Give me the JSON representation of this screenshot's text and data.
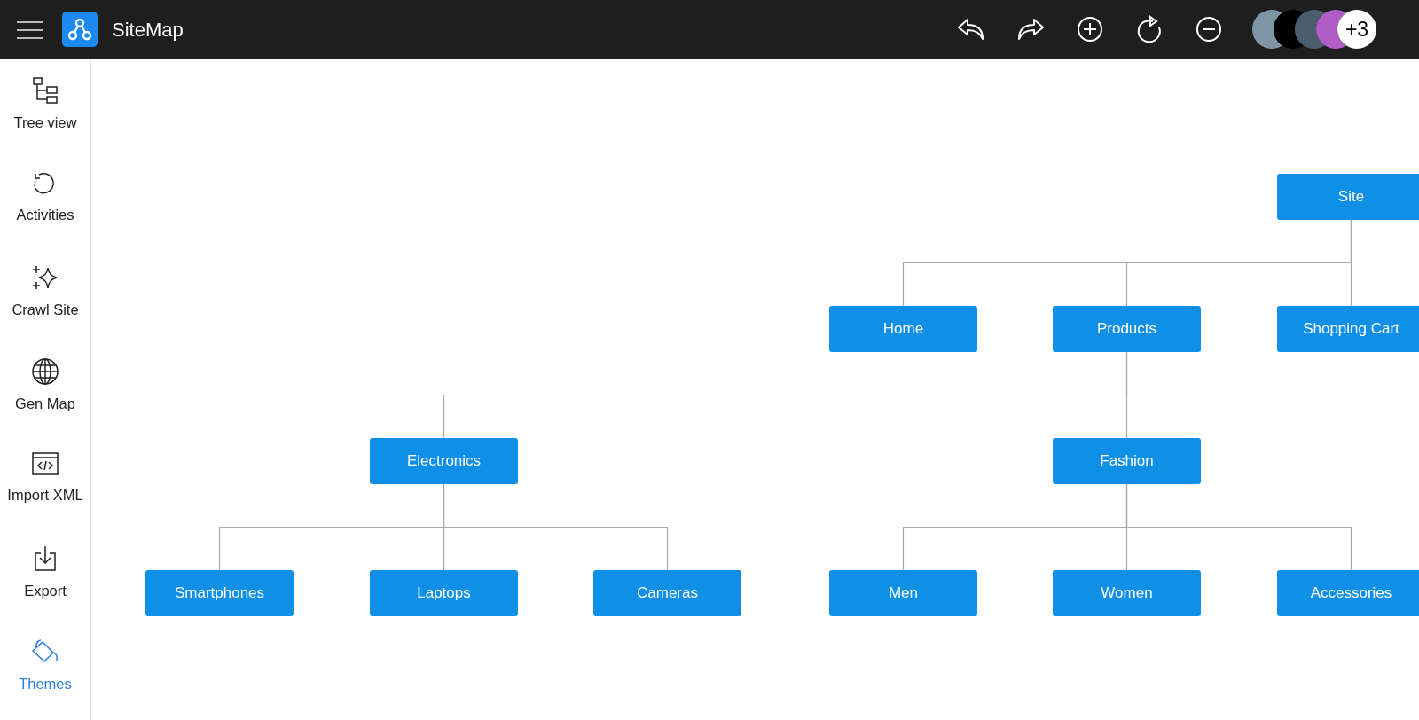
{
  "app": {
    "title": "SiteMap"
  },
  "avatars": [
    {
      "color": "#7d95a5"
    },
    {
      "color": "#000000"
    },
    {
      "color": "#4b5e6e"
    },
    {
      "color": "#b25cc6"
    }
  ],
  "more_avatars": "+3",
  "sidebar": {
    "items": [
      {
        "label": "Tree view",
        "selected": false
      },
      {
        "label": "Activities",
        "selected": false
      },
      {
        "label": "Crawl Site",
        "selected": false
      },
      {
        "label": "Gen Map",
        "selected": false
      },
      {
        "label": "Import XML",
        "selected": false
      },
      {
        "label": "Export",
        "selected": false
      },
      {
        "label": "Themes",
        "selected": true
      }
    ]
  },
  "sitemap": {
    "label": "Site",
    "children": [
      {
        "label": "Home"
      },
      {
        "label": "Products",
        "children": [
          {
            "label": "Electronics",
            "children": [
              {
                "label": "Smartphones"
              },
              {
                "label": "Laptops"
              },
              {
                "label": "Cameras"
              }
            ]
          },
          {
            "label": "Fashion",
            "children": [
              {
                "label": "Men"
              },
              {
                "label": "Women"
              },
              {
                "label": "Accessories"
              }
            ]
          }
        ]
      },
      {
        "label": "Shopping Cart"
      }
    ]
  }
}
